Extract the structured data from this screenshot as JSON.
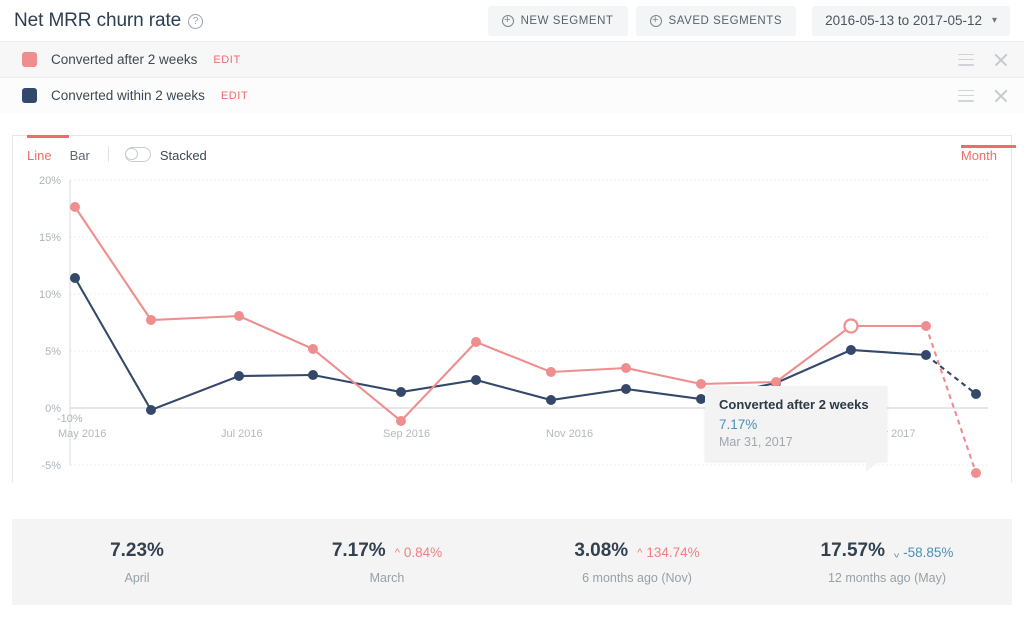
{
  "header": {
    "title": "Net MRR churn rate",
    "help_icon": "question-circle-icon",
    "new_segment_label": "NEW SEGMENT",
    "saved_segments_label": "SAVED SEGMENTS",
    "date_range": "2016-05-13 to 2017-05-12",
    "chevron": "⌄"
  },
  "legend": {
    "edit_label": "EDIT",
    "items": [
      {
        "label": "Converted after 2 weeks",
        "color": "#ef8e8e"
      },
      {
        "label": "Converted within 2 weeks",
        "color": "#33486a"
      }
    ]
  },
  "toolbar": {
    "line_label": "Line",
    "bar_label": "Bar",
    "stacked_label": "Stacked",
    "stacked_on": false,
    "interval_label": "Month"
  },
  "tooltip": {
    "title": "Converted after 2 weeks",
    "value": "7.17%",
    "date": "Mar 31, 2017"
  },
  "stats": [
    {
      "value": "7.23%",
      "delta": "",
      "direction": "",
      "label": "April"
    },
    {
      "value": "7.17%",
      "delta": "0.84%",
      "direction": "up",
      "label": "March"
    },
    {
      "value": "3.08%",
      "delta": "134.74%",
      "direction": "up",
      "label": "6 months ago (Nov)"
    },
    {
      "value": "17.57%",
      "delta": "-58.85%",
      "direction": "down",
      "label": "12 months ago (May)"
    }
  ],
  "chart_data": {
    "type": "line",
    "title": "Net MRR churn rate",
    "xlabel": "",
    "ylabel": "",
    "ylim": [
      -10,
      20
    ],
    "yticks": [
      20,
      15,
      10,
      5,
      0,
      -5,
      -10
    ],
    "ytick_labels": [
      "20%",
      "15%",
      "10%",
      "5%",
      "0%",
      "-5%",
      "-10%"
    ],
    "grid": true,
    "legend_position": "top",
    "x": [
      "May 2016",
      "Jun 2016",
      "Jul 2016",
      "Aug 2016",
      "Sep 2016",
      "Oct 2016",
      "Nov 2016",
      "Dec 2016",
      "Jan 2017",
      "Feb 2017",
      "Mar 2017",
      "Apr 2017",
      "May 2017"
    ],
    "xticks": [
      "May 2016",
      "Jul 2016",
      "Sep 2016",
      "Nov 2016",
      "Jan 2017",
      "Mar 2017"
    ],
    "series": [
      {
        "name": "Converted after 2 weeks",
        "color": "#ef8e8e",
        "values": [
          17.57,
          7.7,
          8.1,
          5.2,
          -1.1,
          5.8,
          3.2,
          3.5,
          2.1,
          2.3,
          7.17,
          7.23,
          -5.7
        ],
        "dashed_from_index": 11,
        "highlight_index": 10
      },
      {
        "name": "Converted within 2 weeks",
        "color": "#33486a",
        "values": [
          11.4,
          -0.2,
          2.85,
          2.9,
          1.4,
          2.5,
          0.7,
          1.65,
          0.75,
          2.25,
          5.1,
          4.65,
          1.25
        ],
        "dashed_from_index": 11,
        "highlight_index": -1
      }
    ]
  }
}
